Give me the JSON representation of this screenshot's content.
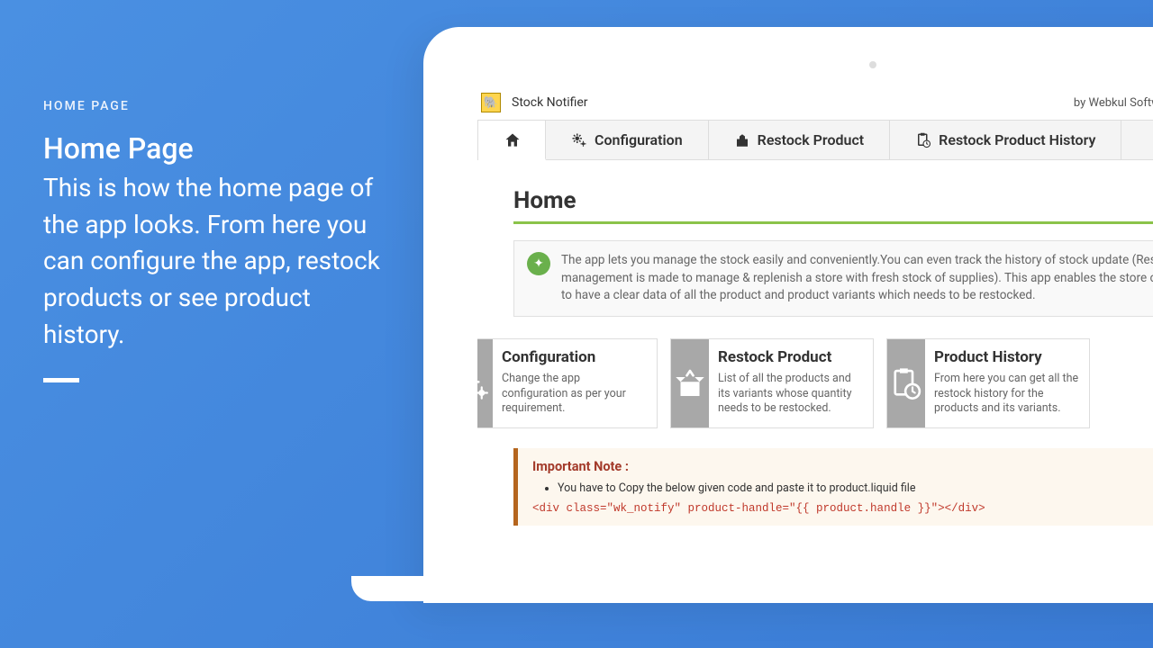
{
  "left": {
    "eyebrow": "HOME PAGE",
    "title": "Home Page",
    "desc": "This is how the home page of the app looks. From here you can configure the app, restock products or see product history."
  },
  "header": {
    "app_name": "Stock Notifier",
    "by_line": "by Webkul Software Pvt Ltd"
  },
  "nav": {
    "home": "",
    "config": "Configuration",
    "restock": "Restock Product",
    "history": "Restock Product History"
  },
  "page": {
    "title": "Home",
    "info": "The app lets you manage the stock easily and conveniently.You can even track the history of stock update (Restock management is made to manage & replenish a store with fresh stock of supplies). This app enables the store owner to have a clear data of all the product and product variants which needs to be restocked."
  },
  "cards": {
    "config": {
      "title": "Configuration",
      "desc": "Change the app configuration as per your requirement."
    },
    "restock": {
      "title": "Restock Product",
      "desc": "List of all the products and its variants whose quantity needs to be restocked."
    },
    "history": {
      "title": "Product History",
      "desc": "From here you can get all the restock history for the products and its variants."
    }
  },
  "note": {
    "title": "Important Note :",
    "bullet": "You have to Copy the below given code and paste it to product.liquid file",
    "code": "<div class=\"wk_notify\" product-handle=\"{{ product.handle }}\"></div>"
  }
}
